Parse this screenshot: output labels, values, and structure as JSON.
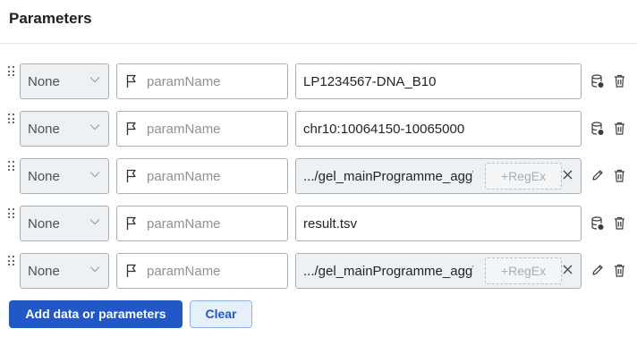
{
  "header": {
    "title": "Parameters"
  },
  "rows": [
    {
      "type": "None",
      "param_placeholder": "paramName",
      "value": "LP1234567-DNA_B10",
      "value_kind": "text",
      "action_icon": "database-icon"
    },
    {
      "type": "None",
      "param_placeholder": "paramName",
      "value": "chr10:10064150-10065000",
      "value_kind": "text",
      "action_icon": "database-icon"
    },
    {
      "type": "None",
      "param_placeholder": "paramName",
      "value": ".../gel_mainProgramme_agg\\",
      "value_kind": "file",
      "regex_label": "+RegEx",
      "action_icon": "pencil-icon"
    },
    {
      "type": "None",
      "param_placeholder": "paramName",
      "value": "result.tsv",
      "value_kind": "text",
      "action_icon": "database-icon"
    },
    {
      "type": "None",
      "param_placeholder": "paramName",
      "value": ".../gel_mainProgramme_agg\\",
      "value_kind": "file",
      "regex_label": "+RegEx",
      "action_icon": "pencil-icon"
    }
  ],
  "footer": {
    "add_label": "Add data or parameters",
    "clear_label": "Clear"
  },
  "colors": {
    "primary": "#2258c6",
    "secondary_bg": "#e6f0fb",
    "field_border": "#a9b1b8",
    "readonly_bg": "#eef1f3"
  }
}
